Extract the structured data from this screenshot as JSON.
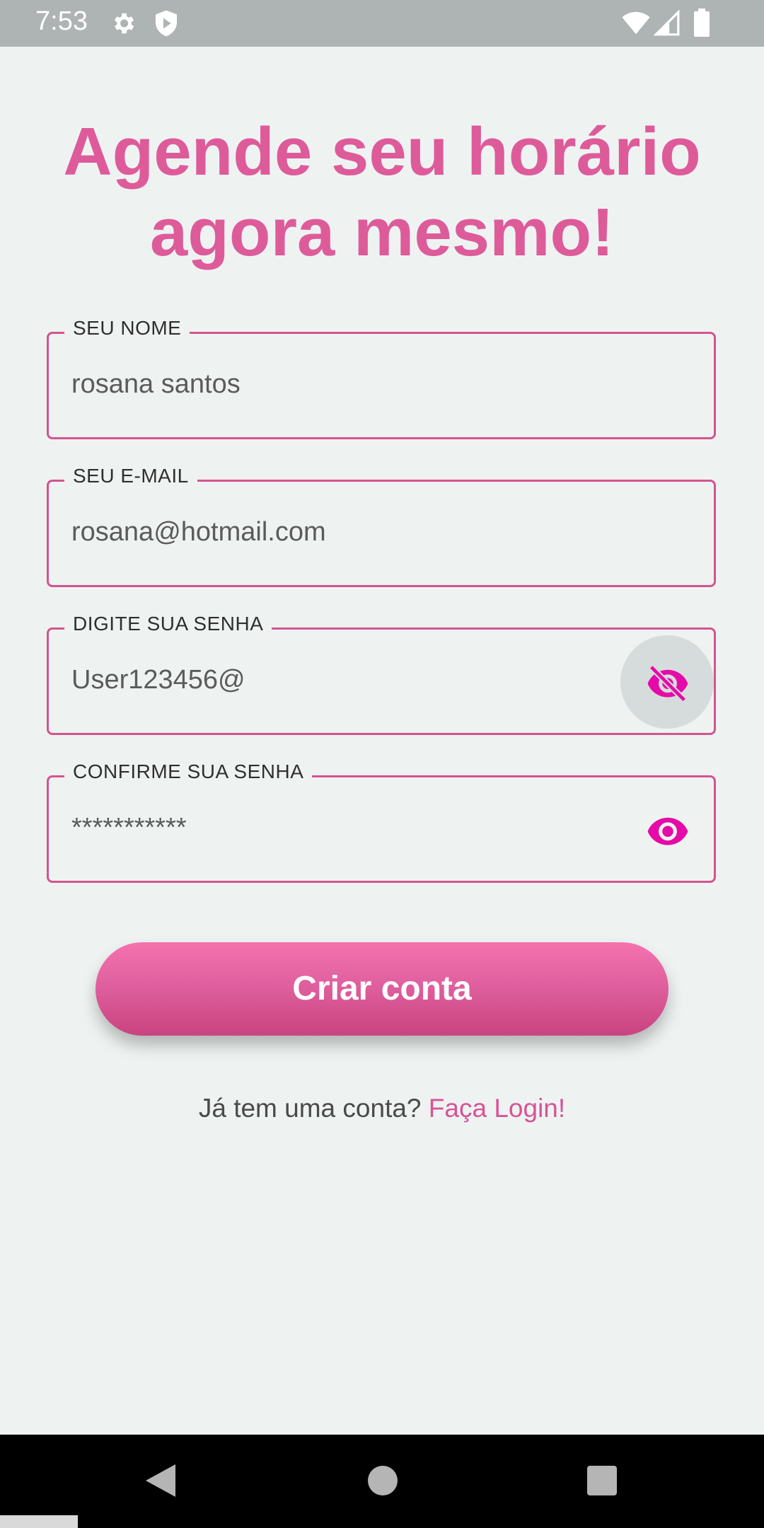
{
  "status_bar": {
    "time": "7:53",
    "icons": [
      "gear-icon",
      "shield-icon",
      "wifi-icon",
      "signal-icon",
      "battery-icon"
    ]
  },
  "headline": {
    "line1": "Agende seu horário",
    "line2": "agora mesmo!"
  },
  "form": {
    "name": {
      "label": "SEU NOME",
      "value": "rosana santos"
    },
    "email": {
      "label": "SEU E-MAIL",
      "value": "rosana@hotmail.com"
    },
    "password": {
      "label": "DIGITE SUA SENHA",
      "value": "User123456@",
      "toggle_icon": "eye-off-icon"
    },
    "confirm": {
      "label": "CONFIRME SUA SENHA",
      "value": "***********",
      "toggle_icon": "eye-icon"
    }
  },
  "create_button": {
    "label": "Criar conta"
  },
  "login_prompt": {
    "text": "Já tem uma conta?",
    "link": "Faça Login!"
  },
  "colors": {
    "accent": "#de5b9a",
    "border": "#d4548f",
    "eye_icon": "#e60aa8",
    "background": "#eef3f2"
  }
}
